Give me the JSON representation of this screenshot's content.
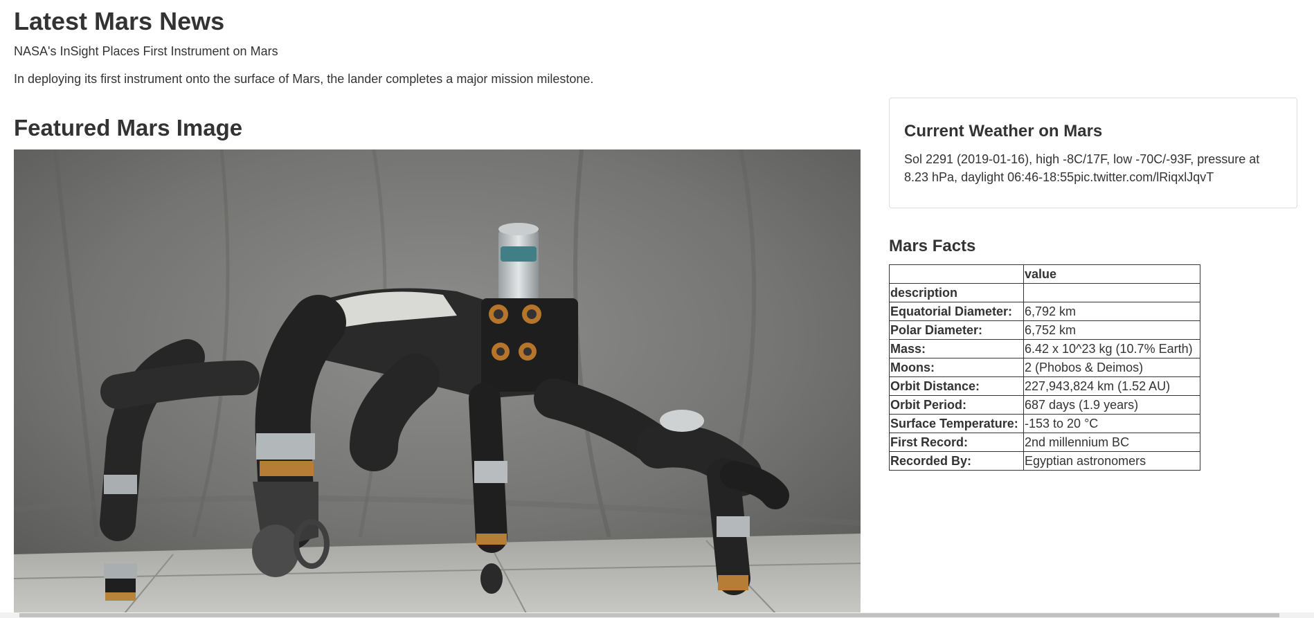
{
  "news": {
    "heading": "Latest Mars News",
    "title": "NASA's InSight Places First Instrument on Mars",
    "teaser": "In deploying its first instrument onto the surface of Mars, the lander completes a major mission milestone."
  },
  "featured": {
    "heading": "Featured Mars Image",
    "image_icon": "robot-photo"
  },
  "weather": {
    "title": "Current Weather on Mars",
    "text": "Sol 2291 (2019-01-16), high -8C/17F, low -70C/-93F, pressure at 8.23 hPa, daylight 06:46-18:55pic.twitter.com/lRiqxlJqvT"
  },
  "facts": {
    "title": "Mars Facts",
    "header_value": "value",
    "header_description": "description",
    "rows": [
      {
        "label": "Equatorial Diameter:",
        "value": "6,792 km"
      },
      {
        "label": "Polar Diameter:",
        "value": "6,752 km"
      },
      {
        "label": "Mass:",
        "value": "6.42 x 10^23 kg (10.7% Earth)"
      },
      {
        "label": "Moons:",
        "value": "2 (Phobos & Deimos)"
      },
      {
        "label": "Orbit Distance:",
        "value": "227,943,824 km (1.52 AU)"
      },
      {
        "label": "Orbit Period:",
        "value": "687 days (1.9 years)"
      },
      {
        "label": "Surface Temperature:",
        "value": "-153 to 20 °C"
      },
      {
        "label": "First Record:",
        "value": "2nd millennium BC"
      },
      {
        "label": "Recorded By:",
        "value": "Egyptian astronomers"
      }
    ]
  }
}
